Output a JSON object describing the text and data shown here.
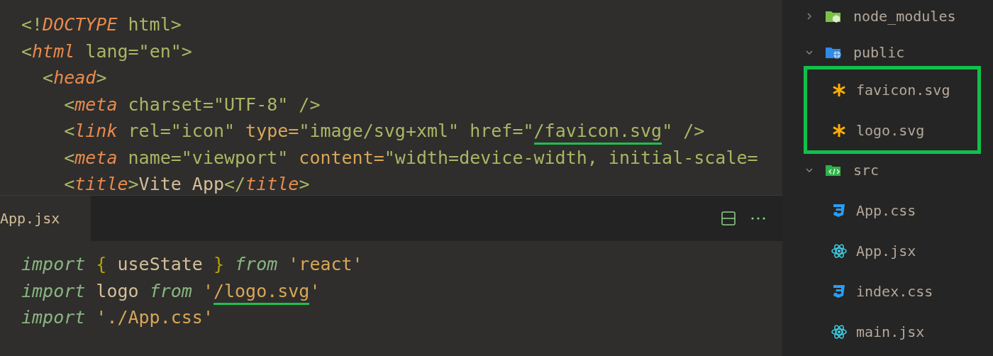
{
  "top_editor": {
    "lines": [
      [
        {
          "kind": "punct",
          "text": "<!"
        },
        {
          "kind": "tag",
          "text": "DOCTYPE"
        },
        {
          "kind": "attr",
          "text": " html"
        },
        {
          "kind": "punct",
          "text": ">"
        }
      ],
      [
        {
          "kind": "punct",
          "text": "<"
        },
        {
          "kind": "tag",
          "text": "html"
        },
        {
          "kind": "attr",
          "text": " lang="
        },
        {
          "kind": "string",
          "text": "\"en\""
        },
        {
          "kind": "punct",
          "text": ">"
        }
      ],
      [
        {
          "kind": "punct",
          "text": "  <"
        },
        {
          "kind": "tag",
          "text": "head"
        },
        {
          "kind": "punct",
          "text": ">"
        }
      ],
      [
        {
          "kind": "punct",
          "text": "    <"
        },
        {
          "kind": "tag",
          "text": "meta"
        },
        {
          "kind": "attr",
          "text": " charset="
        },
        {
          "kind": "string",
          "text": "\"UTF-8\""
        },
        {
          "kind": "punct",
          "text": " />"
        }
      ],
      [
        {
          "kind": "punct",
          "text": "    <"
        },
        {
          "kind": "tag",
          "text": "link"
        },
        {
          "kind": "attr",
          "text": " rel="
        },
        {
          "kind": "string",
          "text": "\"icon\""
        },
        {
          "kind": "attr2",
          "text": " type="
        },
        {
          "kind": "string",
          "text": "\"image/svg+xml\""
        },
        {
          "kind": "attr",
          "text": " href="
        },
        {
          "kind": "string",
          "text": "\""
        },
        {
          "kind": "string",
          "text": "/favicon.svg",
          "highlighted": true
        },
        {
          "kind": "string",
          "text": "\""
        },
        {
          "kind": "punct",
          "text": " />"
        }
      ],
      [
        {
          "kind": "punct",
          "text": "    <"
        },
        {
          "kind": "tag",
          "text": "meta"
        },
        {
          "kind": "attr",
          "text": " name="
        },
        {
          "kind": "string",
          "text": "\"viewport\""
        },
        {
          "kind": "attr2",
          "text": " content="
        },
        {
          "kind": "string",
          "text": "\"width=device-width, initial-scale="
        }
      ],
      [
        {
          "kind": "punct",
          "text": "    <"
        },
        {
          "kind": "tag",
          "text": "title"
        },
        {
          "kind": "punct",
          "text": ">"
        },
        {
          "kind": "text",
          "text": "Vite App"
        },
        {
          "kind": "punct",
          "text": "</"
        },
        {
          "kind": "tag",
          "text": "title"
        },
        {
          "kind": "punct",
          "text": ">"
        }
      ]
    ]
  },
  "tab": {
    "label": "App.jsx",
    "selected": true
  },
  "bottom_editor": {
    "lines": [
      [
        {
          "kind": "keyword",
          "text": "import"
        },
        {
          "kind": "brace",
          "text": " {"
        },
        {
          "kind": "ident",
          "text": " useState "
        },
        {
          "kind": "brace",
          "text": "}"
        },
        {
          "kind": "keyword",
          "text": " from"
        },
        {
          "kind": "str",
          "text": " 'react'"
        }
      ],
      [
        {
          "kind": "keyword",
          "text": "import"
        },
        {
          "kind": "ident",
          "text": " logo "
        },
        {
          "kind": "keyword",
          "text": "from"
        },
        {
          "kind": "str",
          "text": " '"
        },
        {
          "kind": "str",
          "text": "/logo.svg",
          "highlighted": true
        },
        {
          "kind": "str",
          "text": "'"
        }
      ],
      [
        {
          "kind": "keyword",
          "text": "import"
        },
        {
          "kind": "str",
          "text": " './App.css'"
        }
      ]
    ]
  },
  "explorer": {
    "items": [
      {
        "label": "node_modules",
        "kind": "node-folder",
        "expanded": false
      },
      {
        "label": "public",
        "kind": "public-folder",
        "expanded": true,
        "highlighted": true,
        "children": [
          {
            "label": "favicon.svg",
            "kind": "svg"
          },
          {
            "label": "logo.svg",
            "kind": "svg"
          }
        ]
      },
      {
        "label": "src",
        "kind": "src-folder",
        "expanded": true,
        "highlighted": false,
        "children": [
          {
            "label": "App.css",
            "kind": "css"
          },
          {
            "label": "App.jsx",
            "kind": "react"
          },
          {
            "label": "index.css",
            "kind": "css"
          },
          {
            "label": "main.jsx",
            "kind": "react"
          }
        ]
      }
    ]
  }
}
